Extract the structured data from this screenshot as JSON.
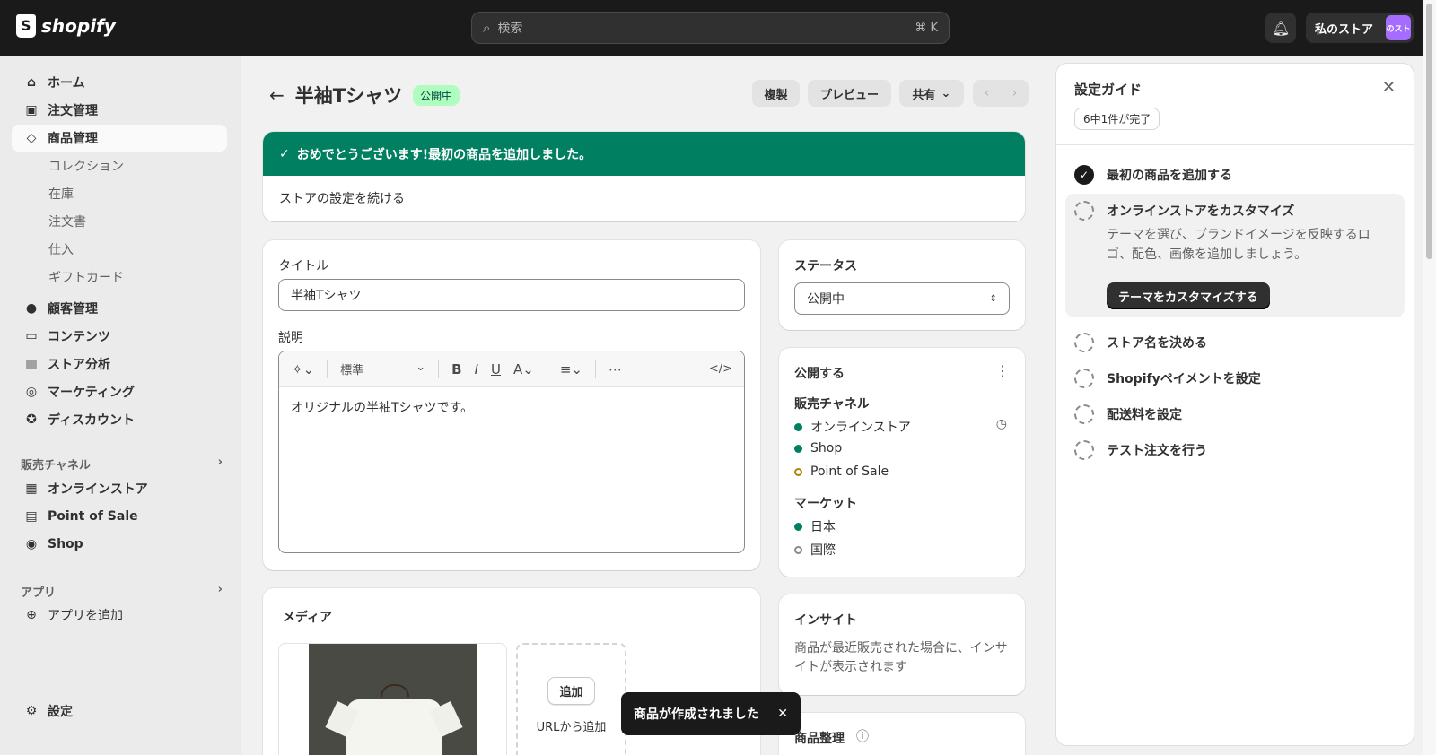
{
  "topbar": {
    "brand": "shopify",
    "search_placeholder": "検索",
    "search_shortcut": "⌘ K",
    "store_name": "私のストア",
    "store_avatar": "のスト"
  },
  "sidebar": {
    "items": [
      {
        "label": "ホーム",
        "icon": "home-icon"
      },
      {
        "label": "注文管理",
        "icon": "inbox-icon"
      },
      {
        "label": "商品管理",
        "icon": "tag-icon"
      },
      {
        "label": "顧客管理",
        "icon": "person-icon"
      },
      {
        "label": "コンテンツ",
        "icon": "image-icon"
      },
      {
        "label": "ストア分析",
        "icon": "chart-icon"
      },
      {
        "label": "マーケティング",
        "icon": "target-icon"
      },
      {
        "label": "ディスカウント",
        "icon": "discount-icon"
      }
    ],
    "sub_items": [
      "コレクション",
      "在庫",
      "注文書",
      "仕入",
      "ギフトカード"
    ],
    "sales_channels_header": "販売チャネル",
    "channels": [
      "オンラインストア",
      "Point of Sale",
      "Shop"
    ],
    "apps_header": "アプリ",
    "add_app": "アプリを追加",
    "settings": "設定"
  },
  "header": {
    "title": "半袖Tシャツ",
    "status_badge": "公開中",
    "duplicate": "複製",
    "preview": "プレビュー",
    "share": "共有"
  },
  "banner": {
    "message": "おめでとうございます!最初の商品を追加しました。",
    "link": "ストアの設定を続ける"
  },
  "product": {
    "title_label": "タイトル",
    "title_value": "半袖Tシャツ",
    "description_label": "説明",
    "format_select": "標準",
    "description_text": "オリジナルの半袖Tシャツです。"
  },
  "media": {
    "heading": "メディア",
    "add_button": "追加",
    "add_from_url": "URLから追加"
  },
  "status_card": {
    "heading": "ステータス",
    "value": "公開中"
  },
  "publishing": {
    "heading": "公開する",
    "channels_label": "販売チャネル",
    "channels": [
      {
        "name": "オンラインストア",
        "state": "active"
      },
      {
        "name": "Shop",
        "state": "active"
      },
      {
        "name": "Point of Sale",
        "state": "pending"
      }
    ],
    "markets_label": "マーケット",
    "markets": [
      {
        "name": "日本",
        "state": "active"
      },
      {
        "name": "国際",
        "state": "inactive"
      }
    ]
  },
  "insights": {
    "heading": "インサイト",
    "text": "商品が最近販売された場合に、インサイトが表示されます"
  },
  "organization": {
    "heading": "商品整理"
  },
  "toast": {
    "message": "商品が作成されました"
  },
  "guide": {
    "title": "設定ガイド",
    "progress": "6中1件が完了",
    "steps": [
      {
        "label": "最初の商品を追加する",
        "done": true
      },
      {
        "label": "オンラインストアをカスタマイズ",
        "done": false
      },
      {
        "label": "ストア名を決める",
        "done": false
      },
      {
        "label": "Shopifyペイメントを設定",
        "done": false
      },
      {
        "label": "配送料を設定",
        "done": false
      },
      {
        "label": "テスト注文を行う",
        "done": false
      }
    ],
    "expanded_description": "テーマを選び、ブランドイメージを反映するロゴ、配色、画像を追加しましょう。",
    "expanded_button": "テーマをカスタマイズする"
  },
  "colors": {
    "topbar": "#1a1a1a",
    "success": "#008060",
    "badge_bg": "#affebf",
    "avatar": "#a66bff"
  }
}
